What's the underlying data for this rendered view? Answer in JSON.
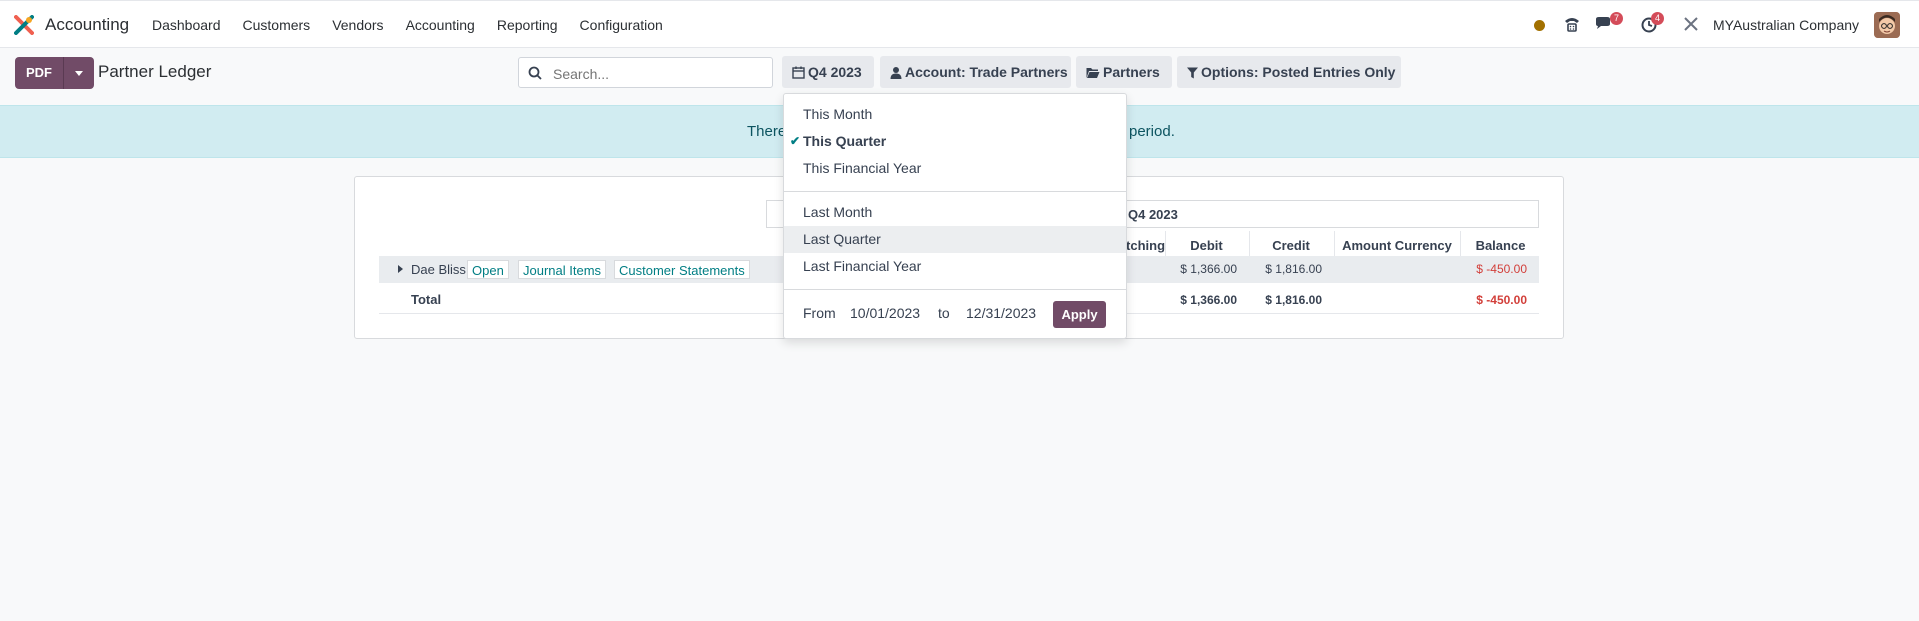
{
  "navbar": {
    "app_name": "Accounting",
    "menu": [
      "Dashboard",
      "Customers",
      "Vendors",
      "Accounting",
      "Reporting",
      "Configuration"
    ],
    "messages_count": "7",
    "activities_count": "4",
    "company": "MYAustralian Company"
  },
  "control_panel": {
    "pdf_label": "PDF",
    "title": "Partner Ledger",
    "search_placeholder": "Search...",
    "date_filter": "Q4 2023",
    "account_filter": "Account: Trade Partners",
    "partners_filter": "Partners",
    "options_filter": "Options: Posted Entries Only"
  },
  "alert": {
    "text_left": "There",
    "text_right": "period."
  },
  "report": {
    "period_label": "Q4 2023",
    "columns": [
      "Matching",
      "Debit",
      "Credit",
      "Amount Currency",
      "Balance"
    ],
    "rows": [
      {
        "partner": "Dae Bliss",
        "actions": [
          "Open",
          "Journal Items",
          "Customer Statements"
        ],
        "debit": "$ 1,366.00",
        "credit": "$ 1,816.00",
        "balance": "$ -450.00"
      }
    ],
    "total": {
      "label": "Total",
      "debit": "$ 1,366.00",
      "credit": "$ 1,816.00",
      "balance": "$ -450.00"
    }
  },
  "date_dropdown": {
    "this_group": [
      "This Month",
      "This Quarter",
      "This Financial Year"
    ],
    "last_group": [
      "Last Month",
      "Last Quarter",
      "Last Financial Year"
    ],
    "selected": "This Quarter",
    "hovered": "Last Quarter",
    "from_label": "From",
    "from_date": "10/01/2023",
    "to_label": "to",
    "to_date": "12/31/2023",
    "apply_label": "Apply"
  },
  "colors": {
    "brand": "#714b67",
    "link": "#017e84",
    "negative": "#d23f3a",
    "alert_bg": "#d1ecf1",
    "badge": "#d44c59"
  }
}
